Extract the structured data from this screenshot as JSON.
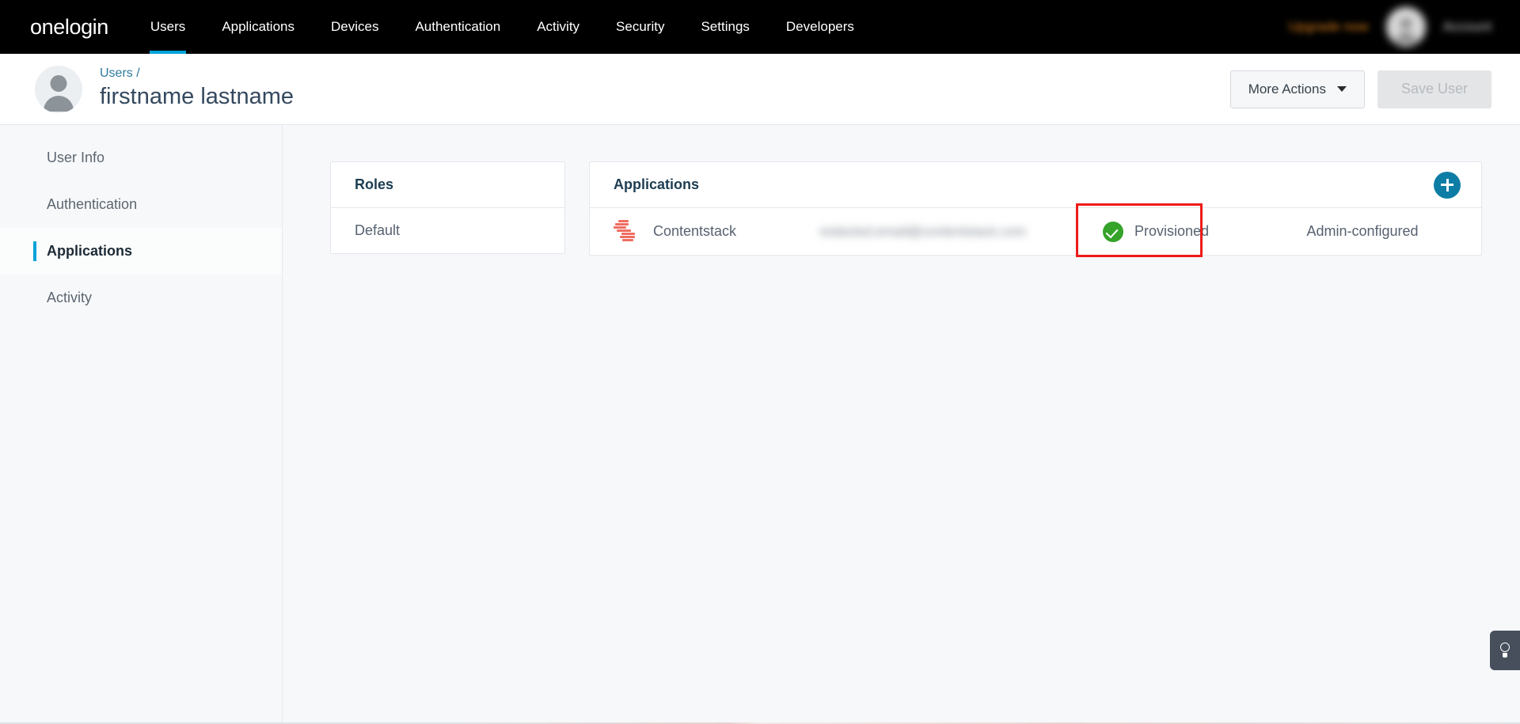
{
  "topnav": {
    "logo": "onelogin",
    "items": [
      {
        "label": "Users",
        "active": true
      },
      {
        "label": "Applications",
        "active": false
      },
      {
        "label": "Devices",
        "active": false
      },
      {
        "label": "Authentication",
        "active": false
      },
      {
        "label": "Activity",
        "active": false
      },
      {
        "label": "Security",
        "active": false
      },
      {
        "label": "Settings",
        "active": false
      },
      {
        "label": "Developers",
        "active": false
      }
    ],
    "upgrade_label": "Upgrade now",
    "username": "Account",
    "accent_color": "#00a3d9",
    "upgrade_color": "#d97d1a"
  },
  "pageheader": {
    "breadcrumb_link": "Users",
    "breadcrumb_separator": "/",
    "title": "firstname lastname",
    "more_actions_label": "More Actions",
    "save_user_label": "Save User"
  },
  "sidebar": {
    "items": [
      {
        "label": "User Info",
        "active": false
      },
      {
        "label": "Authentication",
        "active": false
      },
      {
        "label": "Applications",
        "active": true
      },
      {
        "label": "Activity",
        "active": false
      }
    ]
  },
  "roles_card": {
    "title": "Roles",
    "rows": [
      "Default"
    ]
  },
  "apps_card": {
    "title": "Applications",
    "add_button_label": "+",
    "rows": [
      {
        "icon": "contentstack-logo",
        "name": "Contentstack",
        "email": "redacted.email@contentstack.com",
        "status": "Provisioned",
        "status_icon": "check-circle-icon",
        "status_color": "#35a329",
        "configuration": "Admin-configured",
        "highlighted": true
      }
    ]
  },
  "annotation": {
    "highlight_color": "#ee1b1b",
    "target": "Provisioned"
  },
  "help": {
    "icon": "lightbulb-icon",
    "label": "Help"
  }
}
